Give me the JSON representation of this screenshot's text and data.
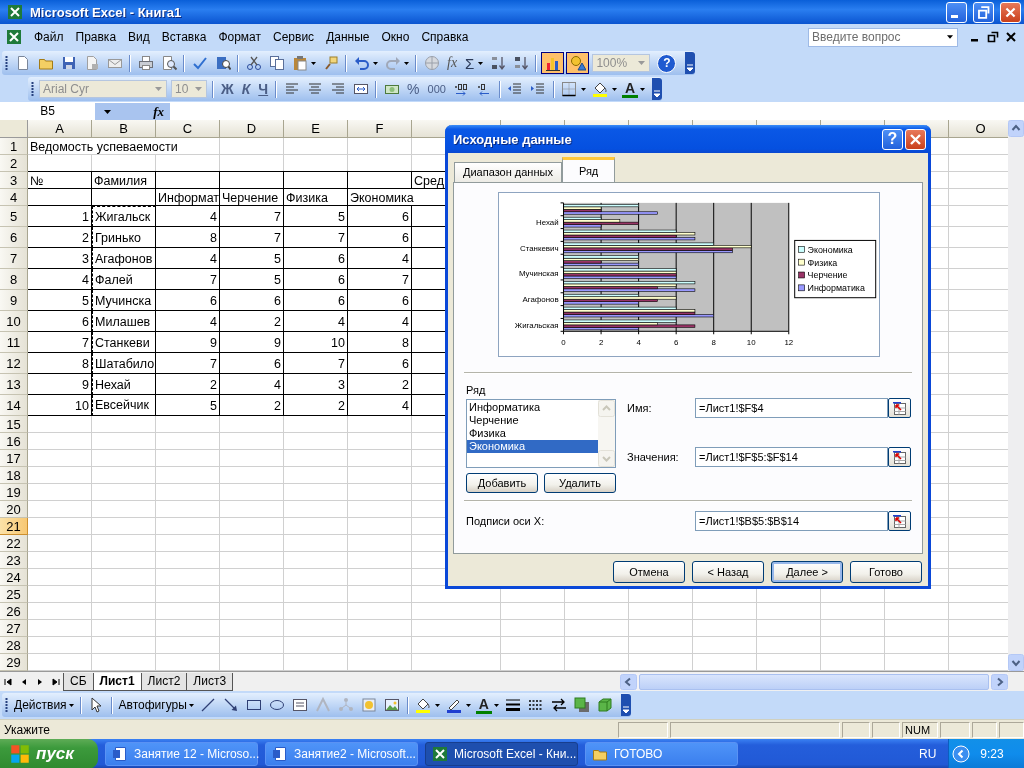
{
  "window": {
    "title": "Microsoft Excel - Книга1"
  },
  "menu": [
    "Файл",
    "Правка",
    "Вид",
    "Вставка",
    "Формат",
    "Сервис",
    "Данные",
    "Окно",
    "Справка"
  ],
  "help_search": {
    "placeholder": "Введите вопрос"
  },
  "standard_toolbar": {
    "function": "fx",
    "sum": "Σ",
    "zoom": "100%",
    "help": "?",
    "chart_wizard_on": true,
    "drawing_on": true
  },
  "formatting_toolbar": {
    "font": "Arial Cyr",
    "size": "10",
    "bold": "Ж",
    "italic": "К",
    "underline": "Ч",
    "percent": "%",
    "thousands": "000",
    "font_color": "A"
  },
  "formula_bar": {
    "name_box": "B5",
    "fx": "fx"
  },
  "sheet": {
    "columns": [
      "A",
      "B",
      "C",
      "D",
      "E",
      "F",
      "O"
    ],
    "rows": [
      {
        "header": "1",
        "kind": "title",
        "selected": false,
        "cells": [
          "Ведомость успеваемости"
        ]
      },
      {
        "header": "2",
        "kind": "blank",
        "selected": false
      },
      {
        "header": "3",
        "kind": "heading",
        "selected": false,
        "cells": [
          "№",
          "Фамилия",
          null,
          null,
          null,
          null,
          "Сред"
        ]
      },
      {
        "header": "4",
        "kind": "heading",
        "selected": false,
        "cells": [
          null,
          null,
          "Информат",
          "Черчение",
          "Физика",
          "Экономика"
        ]
      },
      {
        "header": "5",
        "kind": "record",
        "selected": false,
        "marked": true,
        "cells": [
          "1",
          "Жигальск",
          "4",
          "7",
          "5",
          "6"
        ]
      },
      {
        "header": "6",
        "kind": "record",
        "selected": false,
        "marked": true,
        "cells": [
          "2",
          "Гринько",
          "8",
          "7",
          "7",
          "6"
        ]
      },
      {
        "header": "7",
        "kind": "record",
        "selected": false,
        "marked": true,
        "cells": [
          "3",
          "Агафонов",
          "4",
          "5",
          "6",
          "4"
        ]
      },
      {
        "header": "8",
        "kind": "record",
        "selected": false,
        "marked": true,
        "cells": [
          "4",
          "Фалей",
          "7",
          "5",
          "6",
          "7"
        ]
      },
      {
        "header": "9",
        "kind": "record",
        "selected": false,
        "marked": true,
        "cells": [
          "5",
          "Мучинска",
          "6",
          "6",
          "6",
          "6"
        ]
      },
      {
        "header": "10",
        "kind": "record",
        "selected": false,
        "marked": true,
        "cells": [
          "6",
          "Милашев",
          "4",
          "2",
          "4",
          "4"
        ]
      },
      {
        "header": "11",
        "kind": "record",
        "selected": false,
        "marked": true,
        "cells": [
          "7",
          "Станкеви",
          "9",
          "9",
          "10",
          "8"
        ]
      },
      {
        "header": "12",
        "kind": "record",
        "selected": false,
        "marked": true,
        "cells": [
          "8",
          "Шатабило",
          "7",
          "6",
          "7",
          "6"
        ]
      },
      {
        "header": "13",
        "kind": "record",
        "selected": false,
        "marked": true,
        "cells": [
          "9",
          "Нехай",
          "2",
          "4",
          "3",
          "2"
        ]
      },
      {
        "header": "14",
        "kind": "record",
        "selected": false,
        "marked": true,
        "cells": [
          "10",
          "Евсейчик",
          "5",
          "2",
          "2",
          "4"
        ]
      },
      {
        "header": "15",
        "kind": "blank",
        "selected": false
      },
      {
        "header": "16",
        "kind": "blank",
        "selected": false
      },
      {
        "header": "17",
        "kind": "blank",
        "selected": false
      },
      {
        "header": "18",
        "kind": "blank",
        "selected": false
      },
      {
        "header": "19",
        "kind": "blank",
        "selected": false
      },
      {
        "header": "20",
        "kind": "blank",
        "selected": false
      },
      {
        "header": "21",
        "kind": "blank",
        "selected": true
      },
      {
        "header": "22",
        "kind": "blank",
        "selected": false
      },
      {
        "header": "23",
        "kind": "blank",
        "selected": false
      },
      {
        "header": "24",
        "kind": "blank",
        "selected": false
      },
      {
        "header": "25",
        "kind": "blank",
        "selected": false
      },
      {
        "header": "26",
        "kind": "blank",
        "selected": false
      },
      {
        "header": "27",
        "kind": "blank",
        "selected": false
      },
      {
        "header": "28",
        "kind": "blank",
        "selected": false
      },
      {
        "header": "29",
        "kind": "blank",
        "selected": false
      }
    ]
  },
  "sheet_tabs": [
    {
      "label": "СБ",
      "selected": false
    },
    {
      "label": "Лист1",
      "selected": true
    },
    {
      "label": "Лист2",
      "selected": false
    },
    {
      "label": "Лист3",
      "selected": false
    }
  ],
  "dialog": {
    "title": "Исходные данные",
    "help": "?",
    "tabs": [
      {
        "label": "Диапазон данных",
        "selected": false
      },
      {
        "label": "Ряд",
        "selected": true
      }
    ],
    "chart_data": {
      "type": "bar",
      "orientation": "horizontal",
      "categories": [
        null,
        "Нехай",
        null,
        "Станкевич",
        null,
        "Мучинская",
        null,
        "Агафонов",
        null,
        "Жигальская"
      ],
      "series": [
        {
          "name": "Информатика",
          "color": "#9999ff",
          "values": [
            5,
            2,
            7,
            9,
            4,
            6,
            7,
            4,
            8,
            4
          ]
        },
        {
          "name": "Черчение",
          "color": "#993366",
          "values": [
            2,
            4,
            6,
            9,
            2,
            6,
            5,
            5,
            7,
            7
          ]
        },
        {
          "name": "Физика",
          "color": "#ffffcc",
          "values": [
            2,
            3,
            7,
            10,
            4,
            6,
            6,
            6,
            7,
            5
          ]
        },
        {
          "name": "Экономика",
          "color": "#ccffff",
          "values": [
            4,
            2,
            6,
            8,
            4,
            6,
            7,
            4,
            6,
            6
          ]
        }
      ],
      "xlim": [
        0,
        12
      ],
      "xticks": [
        0,
        2,
        4,
        6,
        8,
        10,
        12
      ],
      "grid": true,
      "legend": true
    },
    "series_label": "Ряд",
    "series_list": [
      {
        "label": "Информатика",
        "selected": false
      },
      {
        "label": "Черчение",
        "selected": false
      },
      {
        "label": "Физика",
        "selected": false
      },
      {
        "label": "Экономика",
        "selected": true
      }
    ],
    "add_button": "Добавить",
    "remove_button": "Удалить",
    "name_label": "Имя:",
    "name_value": "=Лист1!$F$4",
    "values_label": "Значения:",
    "values_value": "=Лист1!$F$5:$F$14",
    "xlabels_label": "Подписи оси X:",
    "xlabels_value": "=Лист1!$B$5:$B$14",
    "buttons": [
      {
        "label": "Отмена",
        "default": false
      },
      {
        "label": "< Назад",
        "default": false
      },
      {
        "label": "Далее >",
        "default": true
      },
      {
        "label": "Готово",
        "default": false
      }
    ]
  },
  "drawing_toolbar": {
    "actions": "Действия",
    "autoshapes": "Автофигуры",
    "font_color": "A"
  },
  "status_bar": {
    "text": "Укажите",
    "num": "NUM"
  },
  "taskbar": {
    "start": "пуск",
    "tasks": [
      {
        "label": "Занятие 12 - Microso...",
        "kind": "word",
        "selected": false
      },
      {
        "label": "Занятие2 - Microsoft...",
        "kind": "word",
        "selected": false
      },
      {
        "label": "Microsoft Excel - Кни...",
        "kind": "excel",
        "selected": true
      },
      {
        "label": "ГОТОВО",
        "kind": "folder",
        "selected": false
      }
    ],
    "language": "RU",
    "clock": "9:23"
  }
}
